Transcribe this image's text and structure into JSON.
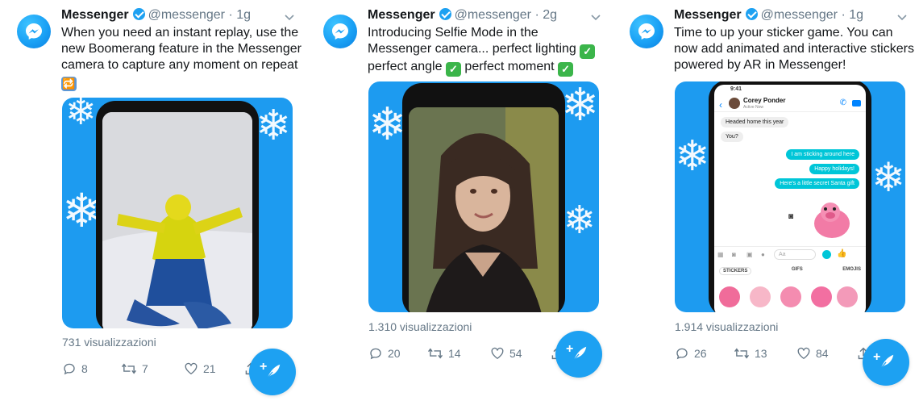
{
  "tweets": [
    {
      "author": "Messenger",
      "handle": "@messenger",
      "separator": "·",
      "time": "1g",
      "text": "When you need an instant replay, use the new Boomerang feature in the Messenger camera to capture any moment on repeat",
      "emoji": "🔁",
      "views": "731 visualizzazioni",
      "replies": "8",
      "retweets": "7",
      "likes": "21"
    },
    {
      "author": "Messenger",
      "handle": "@messenger",
      "separator": "·",
      "time": "2g",
      "text_parts": [
        "Introducing Selfie Mode in the Messenger camera... perfect lighting",
        "perfect angle",
        "perfect moment"
      ],
      "check": "✓",
      "views": "1.310 visualizzazioni",
      "replies": "20",
      "retweets": "14",
      "likes": "54"
    },
    {
      "author": "Messenger",
      "handle": "@messenger",
      "separator": "·",
      "time": "1g",
      "text": "Time to up your sticker game. You can now add animated and interactive stickers powered by AR in Messenger!",
      "views": "1.914 visualizzazioni",
      "replies": "26",
      "retweets": "13",
      "likes": "84",
      "chat": {
        "status_time": "9:41",
        "contact_name": "Corey Ponder",
        "contact_status": "Active Now",
        "msg1": "Headed home this year",
        "msg2": "You?",
        "msg3": "I am sticking around here",
        "msg4": "Happy holidays!",
        "msg5": "Here's a little secret Santa gift",
        "input_placeholder": "Aa",
        "tab_stickers": "STICKERS",
        "tab_gifs": "GIFS",
        "tab_emojis": "EMOJIS"
      }
    }
  ],
  "fab_plus": "+",
  "colors": {
    "brand": "#1da1f2",
    "muted": "#657786",
    "check": "#3bb54a"
  }
}
